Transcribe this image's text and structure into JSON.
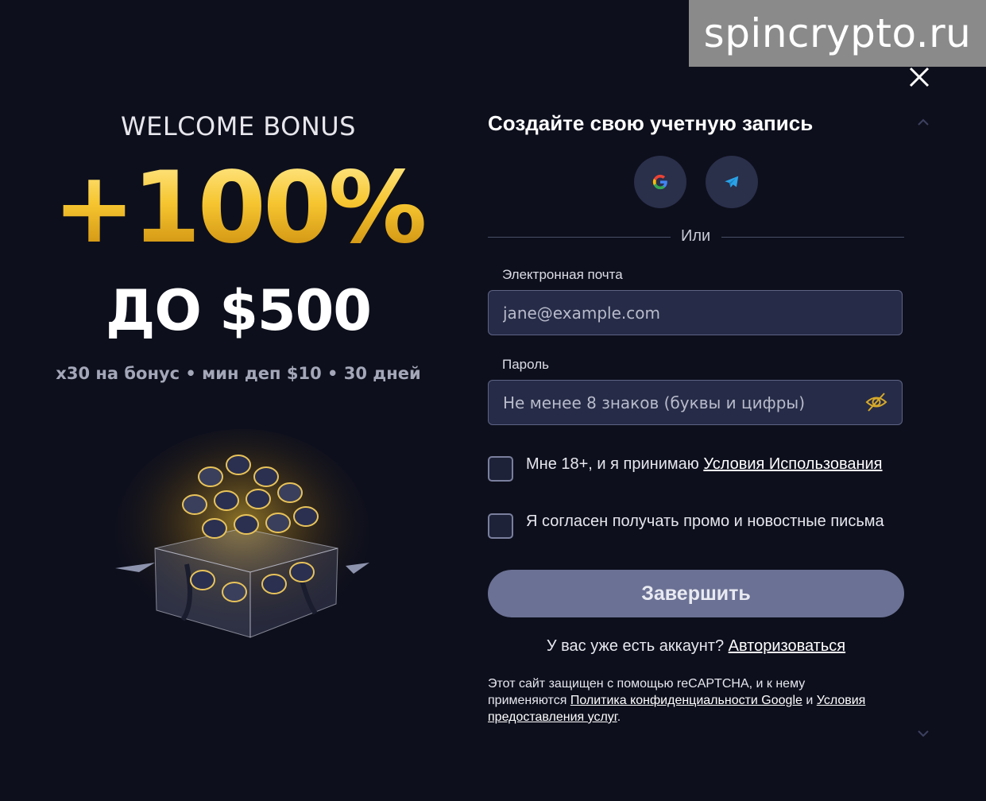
{
  "watermark": "spincrypto.ru",
  "promo": {
    "welcome": "WELCOME BONUS",
    "percent": "+100%",
    "upto": "ДО $500",
    "terms": "x30 на бонус • мин деп $10 • 30 дней"
  },
  "form": {
    "title": "Создайте свою учетную запись",
    "social": [
      "google-icon",
      "telegram-icon"
    ],
    "or_label": "Или",
    "email_label": "Электронная почта",
    "email_placeholder": "jane@example.com",
    "password_label": "Пароль",
    "password_placeholder": "Не менее 8 знаков (буквы и цифры)",
    "age_text": "Мне 18+, и я принимаю",
    "age_link": "Условия Использования",
    "age_checked": false,
    "promo_text": "Я согласен получать промо и новостные письма",
    "promo_checked": false,
    "submit_label": "Завершить",
    "have_account": "У вас уже есть аккаунт?",
    "login_link": "Авторизоваться",
    "recaptcha_prefix": "Этот сайт защищен с помощью reCAPTCHA, и к нему применяются",
    "privacy_link": "Политика конфиденциальности Google",
    "recaptcha_and": "и",
    "tos_link": "Условия предоставления услуг",
    "recaptcha_end": "."
  },
  "colors": {
    "background": "#0d0f1c",
    "gold": "#f6c530",
    "input_bg": "#262b47",
    "button_bg": "#6b7194"
  }
}
